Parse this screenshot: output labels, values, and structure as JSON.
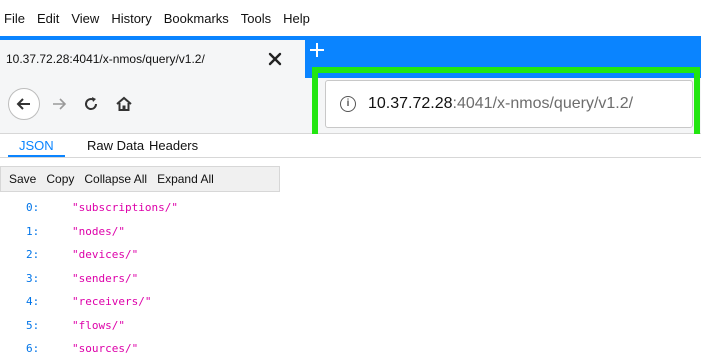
{
  "menubar": {
    "items": [
      "File",
      "Edit",
      "View",
      "History",
      "Bookmarks",
      "Tools",
      "Help"
    ]
  },
  "tab": {
    "title": "10.37.72.28:4041/x-nmos/query/v1.2/",
    "close_icon": "close-icon",
    "new_tab_icon": "plus-icon"
  },
  "nav": {
    "back_icon": "back-arrow-icon",
    "forward_icon": "forward-arrow-icon",
    "reload_icon": "reload-icon",
    "home_icon": "home-icon"
  },
  "urlbar": {
    "info_icon": "info-icon",
    "host": "10.37.72.28",
    "rest": ":4041/x-nmos/query/v1.2/",
    "highlight_color": "#22e610"
  },
  "viewer_tabs": {
    "json": "JSON",
    "raw": "Raw Data",
    "headers": "Headers"
  },
  "toolbar": {
    "save": "Save",
    "copy": "Copy",
    "collapse_all": "Collapse All",
    "expand_all": "Expand All"
  },
  "json_rows": [
    {
      "key": "0:",
      "value": "\"subscriptions/\""
    },
    {
      "key": "1:",
      "value": "\"nodes/\""
    },
    {
      "key": "2:",
      "value": "\"devices/\""
    },
    {
      "key": "3:",
      "value": "\"senders/\""
    },
    {
      "key": "4:",
      "value": "\"receivers/\""
    },
    {
      "key": "5:",
      "value": "\"flows/\""
    },
    {
      "key": "6:",
      "value": "\"sources/\""
    }
  ],
  "colors": {
    "accent": "#0a84ff",
    "json_key": "#0074e8",
    "json_string": "#dd00a9"
  }
}
